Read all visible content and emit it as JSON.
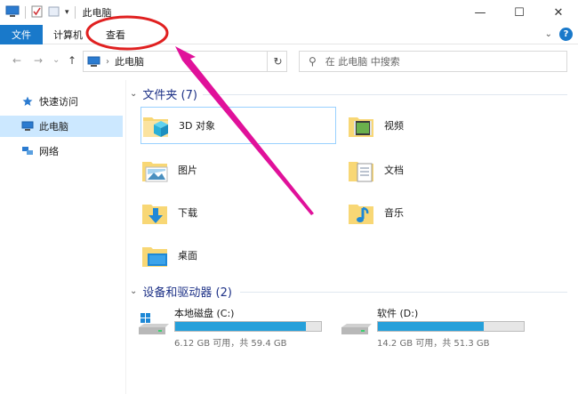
{
  "window": {
    "title": "此电脑",
    "minimize": "—",
    "maximize": "☐",
    "close": "✕"
  },
  "ribbon": {
    "file_label": "文件",
    "tabs": [
      "计算机",
      "查看"
    ],
    "help": "?"
  },
  "navigation": {
    "back": "←",
    "forward": "→",
    "recent": "⌄",
    "up": "↑",
    "address_location": "此电脑",
    "refresh": "↻",
    "search_placeholder": "在 此电脑 中搜索"
  },
  "sidebar": {
    "items": [
      {
        "label": "快速访问",
        "icon": "star-icon"
      },
      {
        "label": "此电脑",
        "icon": "computer-icon",
        "selected": true
      },
      {
        "label": "网络",
        "icon": "network-icon"
      }
    ]
  },
  "folders_group": {
    "header": "文件夹 (7)",
    "items": [
      {
        "label": "3D 对象",
        "icon": "3d-objects-folder-icon"
      },
      {
        "label": "视频",
        "icon": "videos-folder-icon"
      },
      {
        "label": "图片",
        "icon": "pictures-folder-icon"
      },
      {
        "label": "文档",
        "icon": "documents-folder-icon"
      },
      {
        "label": "下载",
        "icon": "downloads-folder-icon"
      },
      {
        "label": "音乐",
        "icon": "music-folder-icon"
      },
      {
        "label": "桌面",
        "icon": "desktop-folder-icon"
      }
    ]
  },
  "drives_group": {
    "header": "设备和驱动器 (2)",
    "items": [
      {
        "label": "本地磁盘 (C:)",
        "detail": "6.12 GB 可用，共 59.4 GB",
        "used_fraction": 0.897
      },
      {
        "label": "软件 (D:)",
        "detail": "14.2 GB 可用，共 51.3 GB",
        "used_fraction": 0.723
      }
    ]
  },
  "colors": {
    "accent": "#1979ca",
    "selection": "#cce8ff",
    "drive_fill": "#26a0da",
    "annotation": "#e0119a",
    "folder": "#f8d775"
  }
}
